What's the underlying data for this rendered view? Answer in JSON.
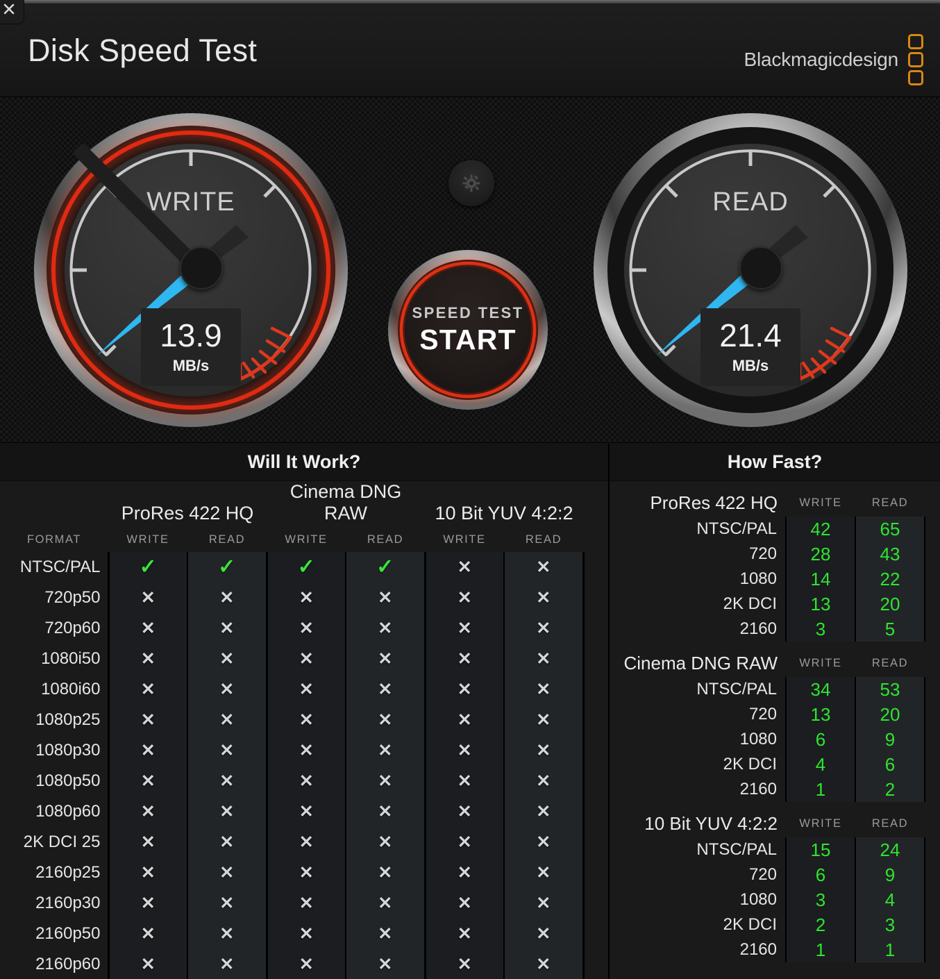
{
  "window": {
    "close_icon": "close-icon",
    "title": "Disk Speed Test"
  },
  "brand": {
    "name": "Blackmagicdesign",
    "mark_color": "#d98714"
  },
  "gauges": {
    "write": {
      "label": "WRITE",
      "value": "13.9",
      "unit": "MB/s",
      "ring_color": "#e02b12",
      "needle_color": "#2eb7f0"
    },
    "read": {
      "label": "READ",
      "value": "21.4",
      "unit": "MB/s",
      "ring_color": "#9a9a9a",
      "needle_color": "#2eb7f0"
    }
  },
  "controls": {
    "gear_icon": "gear-icon",
    "start_sub": "SPEED TEST",
    "start_main": "START"
  },
  "will_it_work": {
    "title": "Will It Work?",
    "format_header": "FORMAT",
    "groups": [
      {
        "name": "ProRes 422 HQ",
        "columns": [
          "WRITE",
          "READ"
        ]
      },
      {
        "name": "Cinema DNG RAW",
        "columns": [
          "WRITE",
          "READ"
        ]
      },
      {
        "name": "10 Bit YUV 4:2:2",
        "columns": [
          "WRITE",
          "READ"
        ]
      }
    ],
    "pass_symbol": "✓",
    "fail_symbol": "✕",
    "rows": [
      {
        "format": "NTSC/PAL",
        "cells": [
          true,
          true,
          true,
          true,
          false,
          false
        ]
      },
      {
        "format": "720p50",
        "cells": [
          false,
          false,
          false,
          false,
          false,
          false
        ]
      },
      {
        "format": "720p60",
        "cells": [
          false,
          false,
          false,
          false,
          false,
          false
        ]
      },
      {
        "format": "1080i50",
        "cells": [
          false,
          false,
          false,
          false,
          false,
          false
        ]
      },
      {
        "format": "1080i60",
        "cells": [
          false,
          false,
          false,
          false,
          false,
          false
        ]
      },
      {
        "format": "1080p25",
        "cells": [
          false,
          false,
          false,
          false,
          false,
          false
        ]
      },
      {
        "format": "1080p30",
        "cells": [
          false,
          false,
          false,
          false,
          false,
          false
        ]
      },
      {
        "format": "1080p50",
        "cells": [
          false,
          false,
          false,
          false,
          false,
          false
        ]
      },
      {
        "format": "1080p60",
        "cells": [
          false,
          false,
          false,
          false,
          false,
          false
        ]
      },
      {
        "format": "2K DCI 25",
        "cells": [
          false,
          false,
          false,
          false,
          false,
          false
        ]
      },
      {
        "format": "2160p25",
        "cells": [
          false,
          false,
          false,
          false,
          false,
          false
        ]
      },
      {
        "format": "2160p30",
        "cells": [
          false,
          false,
          false,
          false,
          false,
          false
        ]
      },
      {
        "format": "2160p50",
        "cells": [
          false,
          false,
          false,
          false,
          false,
          false
        ]
      },
      {
        "format": "2160p60",
        "cells": [
          false,
          false,
          false,
          false,
          false,
          false
        ]
      }
    ]
  },
  "how_fast": {
    "title": "How Fast?",
    "write_header": "WRITE",
    "read_header": "READ",
    "sections": [
      {
        "name": "ProRes 422 HQ",
        "rows": [
          {
            "label": "NTSC/PAL",
            "write": "42",
            "read": "65"
          },
          {
            "label": "720",
            "write": "28",
            "read": "43"
          },
          {
            "label": "1080",
            "write": "14",
            "read": "22"
          },
          {
            "label": "2K DCI",
            "write": "13",
            "read": "20"
          },
          {
            "label": "2160",
            "write": "3",
            "read": "5"
          }
        ]
      },
      {
        "name": "Cinema DNG RAW",
        "rows": [
          {
            "label": "NTSC/PAL",
            "write": "34",
            "read": "53"
          },
          {
            "label": "720",
            "write": "13",
            "read": "20"
          },
          {
            "label": "1080",
            "write": "6",
            "read": "9"
          },
          {
            "label": "2K DCI",
            "write": "4",
            "read": "6"
          },
          {
            "label": "2160",
            "write": "1",
            "read": "2"
          }
        ]
      },
      {
        "name": "10 Bit YUV 4:2:2",
        "rows": [
          {
            "label": "NTSC/PAL",
            "write": "15",
            "read": "24"
          },
          {
            "label": "720",
            "write": "6",
            "read": "9"
          },
          {
            "label": "1080",
            "write": "3",
            "read": "4"
          },
          {
            "label": "2K DCI",
            "write": "2",
            "read": "3"
          },
          {
            "label": "2160",
            "write": "1",
            "read": "1"
          }
        ]
      }
    ]
  },
  "colors": {
    "pass_green": "#3ce43c",
    "value_green": "#2ee52e",
    "fail_gray": "#d6d6d6",
    "accent_red": "#e02b12",
    "needle_blue": "#2eb7f0"
  }
}
